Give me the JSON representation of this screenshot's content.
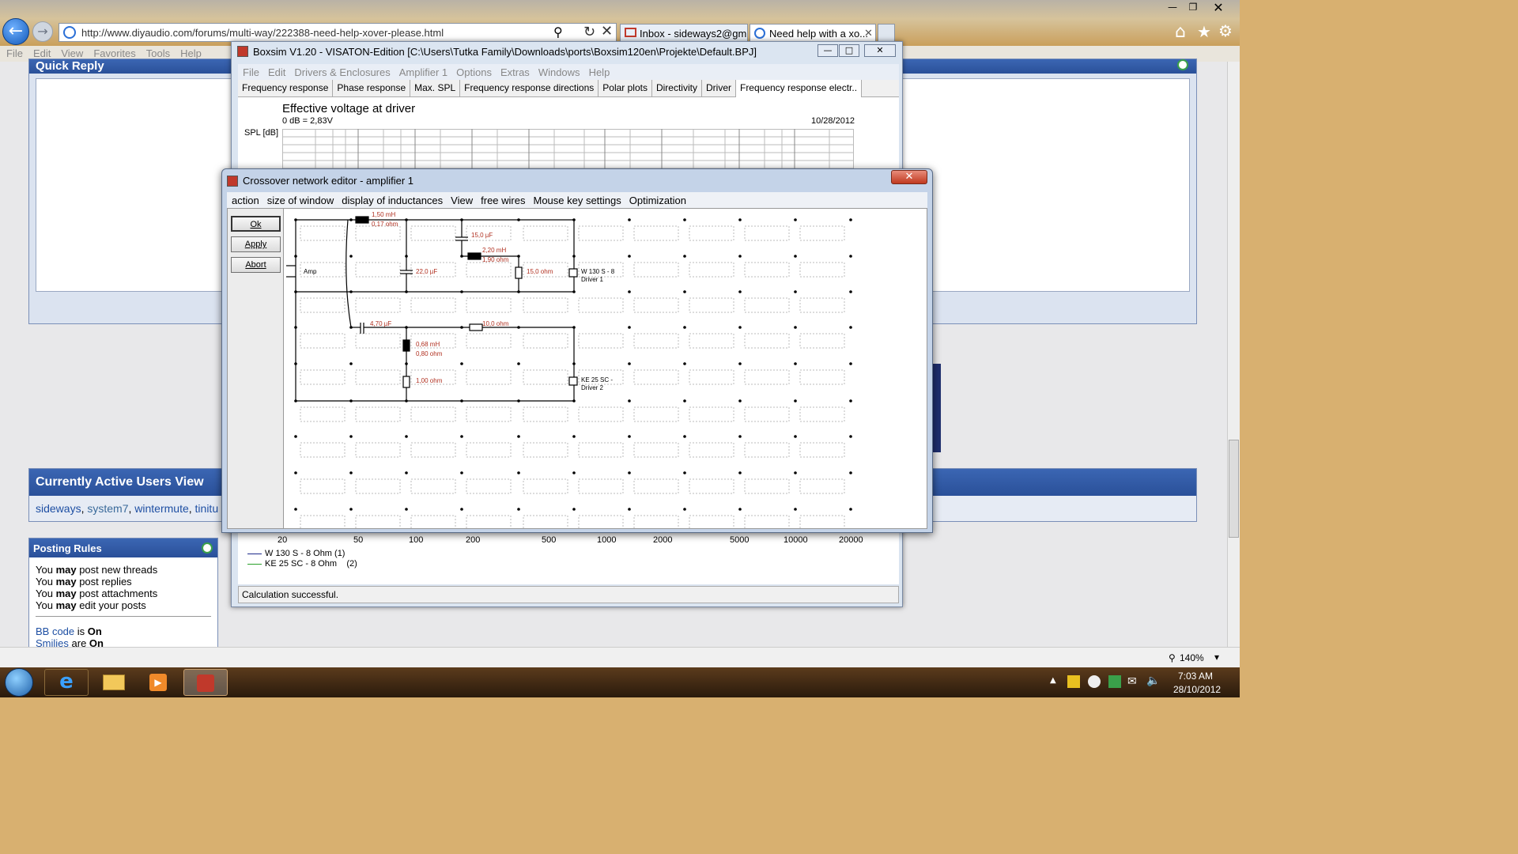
{
  "browser": {
    "url": "http://www.diyaudio.com/forums/multi-way/222388-need-help-xover-please.html",
    "tabs": [
      {
        "label": "Inbox - sideways2@gm..."
      },
      {
        "label": "Need help with a xo..."
      }
    ],
    "menu": [
      "File",
      "Edit",
      "View",
      "Favorites",
      "Tools",
      "Help"
    ],
    "zoom": "140%"
  },
  "webpage": {
    "quick_reply_title": "Quick Reply",
    "active_users_title": "Currently Active Users View",
    "active_users": [
      "sideways",
      "system7",
      "wintermute",
      "tinitu"
    ],
    "posting_rules": {
      "title": "Posting Rules",
      "rules": [
        {
          "pre": "You ",
          "bold": "may",
          "post": " post new threads"
        },
        {
          "pre": "You ",
          "bold": "may",
          "post": " post replies"
        },
        {
          "pre": "You ",
          "bold": "may",
          "post": " post attachments"
        },
        {
          "pre": "You ",
          "bold": "may",
          "post": " edit your posts"
        }
      ],
      "bbcode_label": "BB code",
      "bbcode_is": " is ",
      "bbcode_value": "On",
      "smilies_label": "Smilies",
      "smilies_are": " are ",
      "smilies_value": "On"
    }
  },
  "boxsim": {
    "title": "Boxsim V1.20 - VISATON-Edition [C:\\Users\\Tutka Family\\Downloads\\ports\\Boxsim120en\\Projekte\\Default.BPJ]",
    "menu": [
      "File",
      "Edit",
      "Drivers & Enclosures",
      "Amplifier 1",
      "Options",
      "Extras",
      "Windows",
      "Help"
    ],
    "tabs": [
      "Frequency response",
      "Phase response",
      "Max. SPL",
      "Frequency response directions",
      "Polar plots",
      "Directivity",
      "Driver",
      "Frequency response electr.."
    ],
    "chart_title": "Effective voltage at driver",
    "chart_subtitle": "0 dB = 2,83V",
    "chart_date": "10/28/2012",
    "ylabel": "SPL [dB]",
    "x_ticks": [
      "20",
      "50",
      "100",
      "200",
      "500",
      "1000",
      "2000",
      "5000",
      "10000",
      "20000"
    ],
    "legend": [
      "W 130 S - 8 Ohm (1)",
      "KE 25 SC - 8 Ohm    (2)"
    ],
    "legend_colors": [
      "#1d2a8a",
      "#2aa02a"
    ],
    "status": "Calculation successful."
  },
  "xover": {
    "title": "Crossover network editor - amplifier 1",
    "menu": [
      "action",
      "size of window",
      "display of inductances",
      "View",
      "free wires",
      "Mouse key settings",
      "Optimization"
    ],
    "buttons": {
      "ok": "Ok",
      "apply": "Apply",
      "abort": "Abort"
    },
    "amp_label": "Amp",
    "components": {
      "l1": [
        "1,50 mH",
        "0,17 ohm"
      ],
      "c1": "15,0 µF",
      "l2": [
        "2,20 mH",
        "1,90 ohm"
      ],
      "c2": "22,0 µF",
      "r1": "15,0 ohm",
      "c3": "4,70 µF",
      "r2": "10,0 ohm",
      "l3": [
        "0,68 mH",
        "0,80 ohm"
      ],
      "r3": "1,00 ohm"
    },
    "drivers": [
      [
        "W 130 S - 8",
        "Driver 1"
      ],
      [
        "KE 25 SC -",
        "Driver 2"
      ]
    ]
  },
  "taskbar": {
    "time": "7:03 AM",
    "date": "28/10/2012"
  }
}
